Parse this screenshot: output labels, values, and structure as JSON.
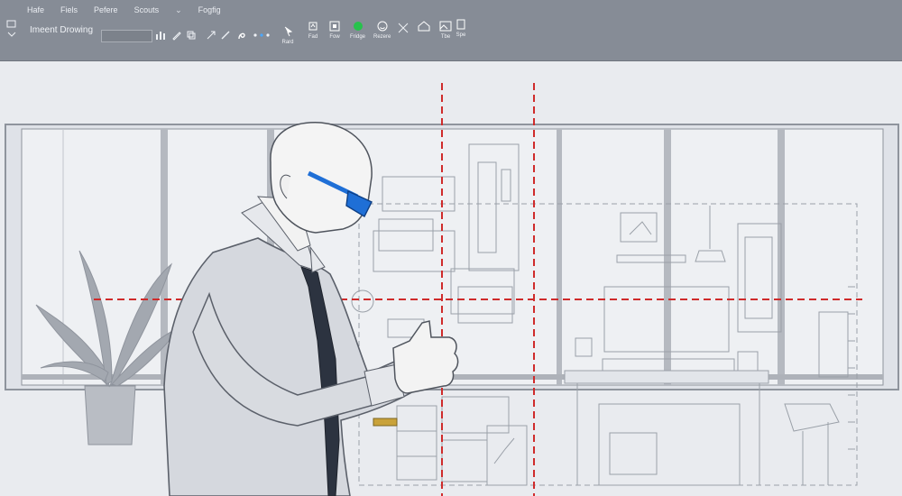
{
  "menu": {
    "items": [
      "Hafe",
      "Fiels",
      "Pefere",
      "Scouts",
      "Fogfig"
    ],
    "dropdown_arrow": "chevron-down-icon"
  },
  "ribbon": {
    "doc_title": "Imeent Drowing",
    "buttons": [
      {
        "name": "arrow-icon-tool",
        "label": "Rard"
      },
      {
        "name": "select-tool",
        "label": "Fad"
      },
      {
        "name": "frame-tool",
        "label": "Fow"
      },
      {
        "name": "green-dot-tool",
        "label": "Fridge"
      },
      {
        "name": "smile-tool",
        "label": "Rezere"
      },
      {
        "name": "home-tool",
        "label": "Tbe"
      },
      {
        "name": "glasses-tool",
        "label": "Spe"
      }
    ]
  },
  "colors": {
    "ribbon": "#868c96",
    "canvas": "#e9ebef",
    "guide_lines": "#cf2b2b",
    "sketch": "#8f949d",
    "glasses": "#1f6fd6"
  }
}
